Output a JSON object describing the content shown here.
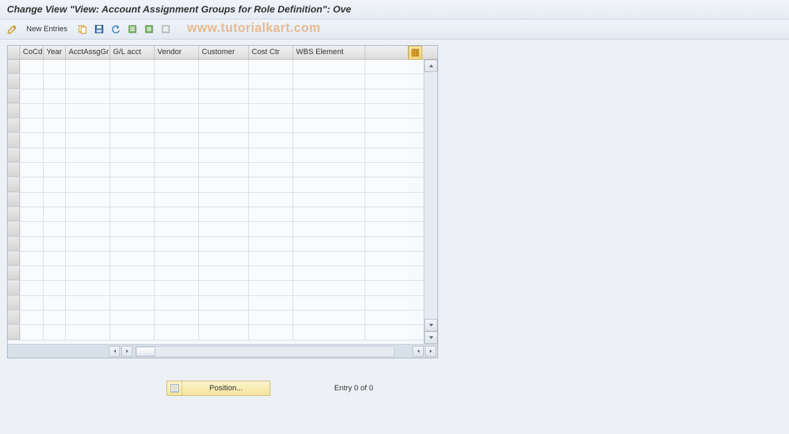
{
  "title": "Change View \"View: Account Assignment Groups for Role Definition\": Ove",
  "watermark": "www.tutorialkart.com",
  "toolbar": {
    "new_entries_label": "New Entries"
  },
  "columns": {
    "cocd": "CoCd",
    "year": "Year",
    "acctassggr": "AcctAssgGr",
    "glacct": "G/L acct",
    "vendor": "Vendor",
    "customer": "Customer",
    "costctr": "Cost Ctr",
    "wbs": "WBS Element"
  },
  "footer": {
    "position_label": "Position...",
    "entry_text": "Entry 0 of 0"
  }
}
